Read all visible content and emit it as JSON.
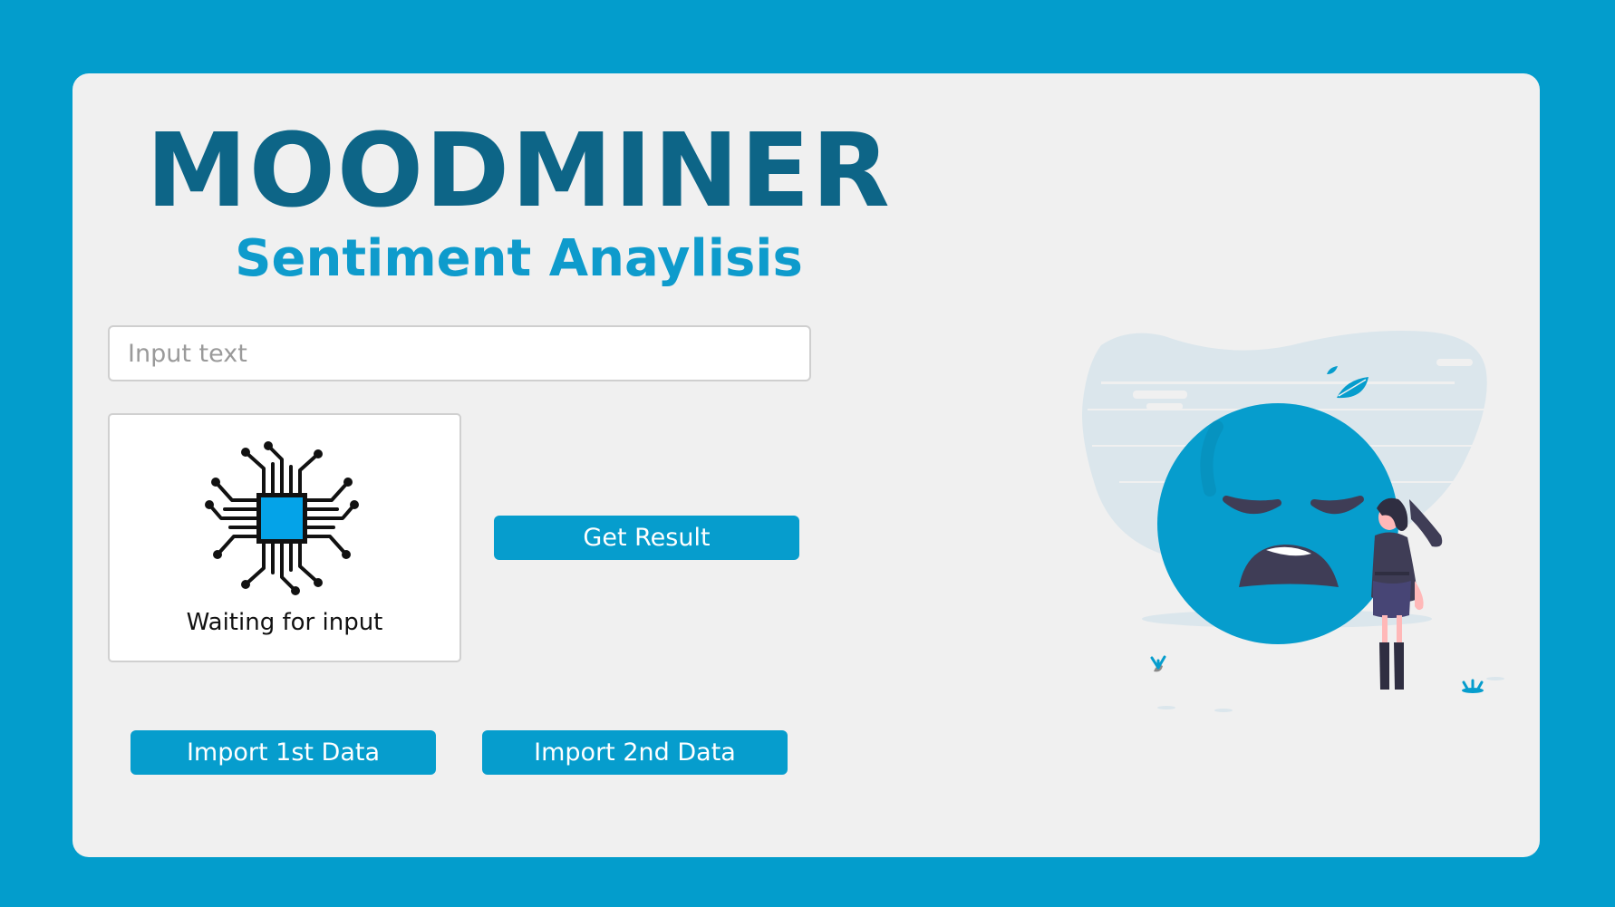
{
  "header": {
    "title": "MOODMINER",
    "subtitle": "Sentiment Anaylisis"
  },
  "input": {
    "placeholder": "Input text",
    "value": ""
  },
  "result_panel": {
    "icon": "cpu-chip-icon",
    "status": "Waiting for input"
  },
  "actions": {
    "get_result_label": "Get Result",
    "import_first_label": "Import 1st Data",
    "import_second_label": "Import 2nd Data"
  },
  "illustration": {
    "icon": "sad-face-illustration"
  },
  "colors": {
    "background": "#039dcc",
    "card": "#f0f0f0",
    "title": "#0d6587",
    "subtitle": "#0e9bcc",
    "button": "#069dcd",
    "chip": "#04a3e8"
  }
}
